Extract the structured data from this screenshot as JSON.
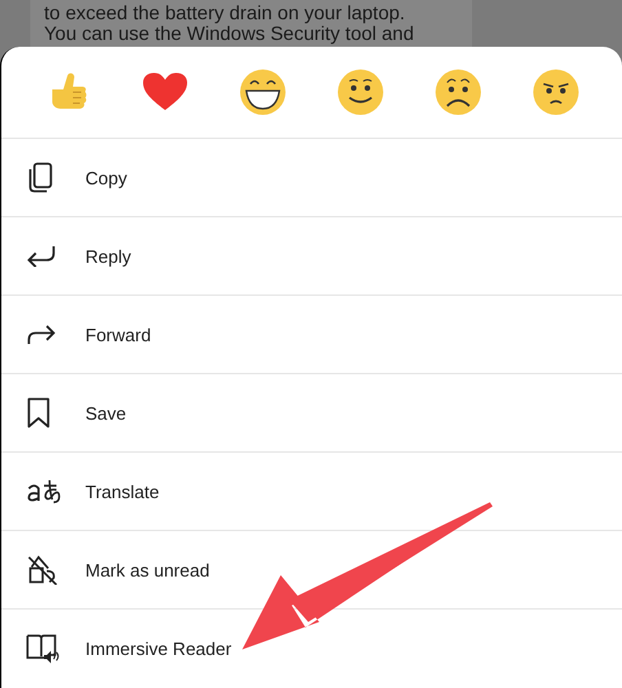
{
  "background_message": {
    "lines": [
      "to exceed the battery drain on your laptop.",
      "You can use the Windows Security tool and"
    ]
  },
  "reactions": [
    {
      "kind": "like"
    },
    {
      "kind": "heart"
    },
    {
      "kind": "laugh"
    },
    {
      "kind": "smile"
    },
    {
      "kind": "sad"
    },
    {
      "kind": "angry"
    }
  ],
  "menu_items": [
    {
      "kind": "copy",
      "label": "Copy"
    },
    {
      "kind": "reply",
      "label": "Reply"
    },
    {
      "kind": "forward",
      "label": "Forward"
    },
    {
      "kind": "save",
      "label": "Save"
    },
    {
      "kind": "translate",
      "label": "Translate"
    },
    {
      "kind": "unread",
      "label": "Mark as unread"
    },
    {
      "kind": "reader",
      "label": "Immersive Reader"
    }
  ]
}
